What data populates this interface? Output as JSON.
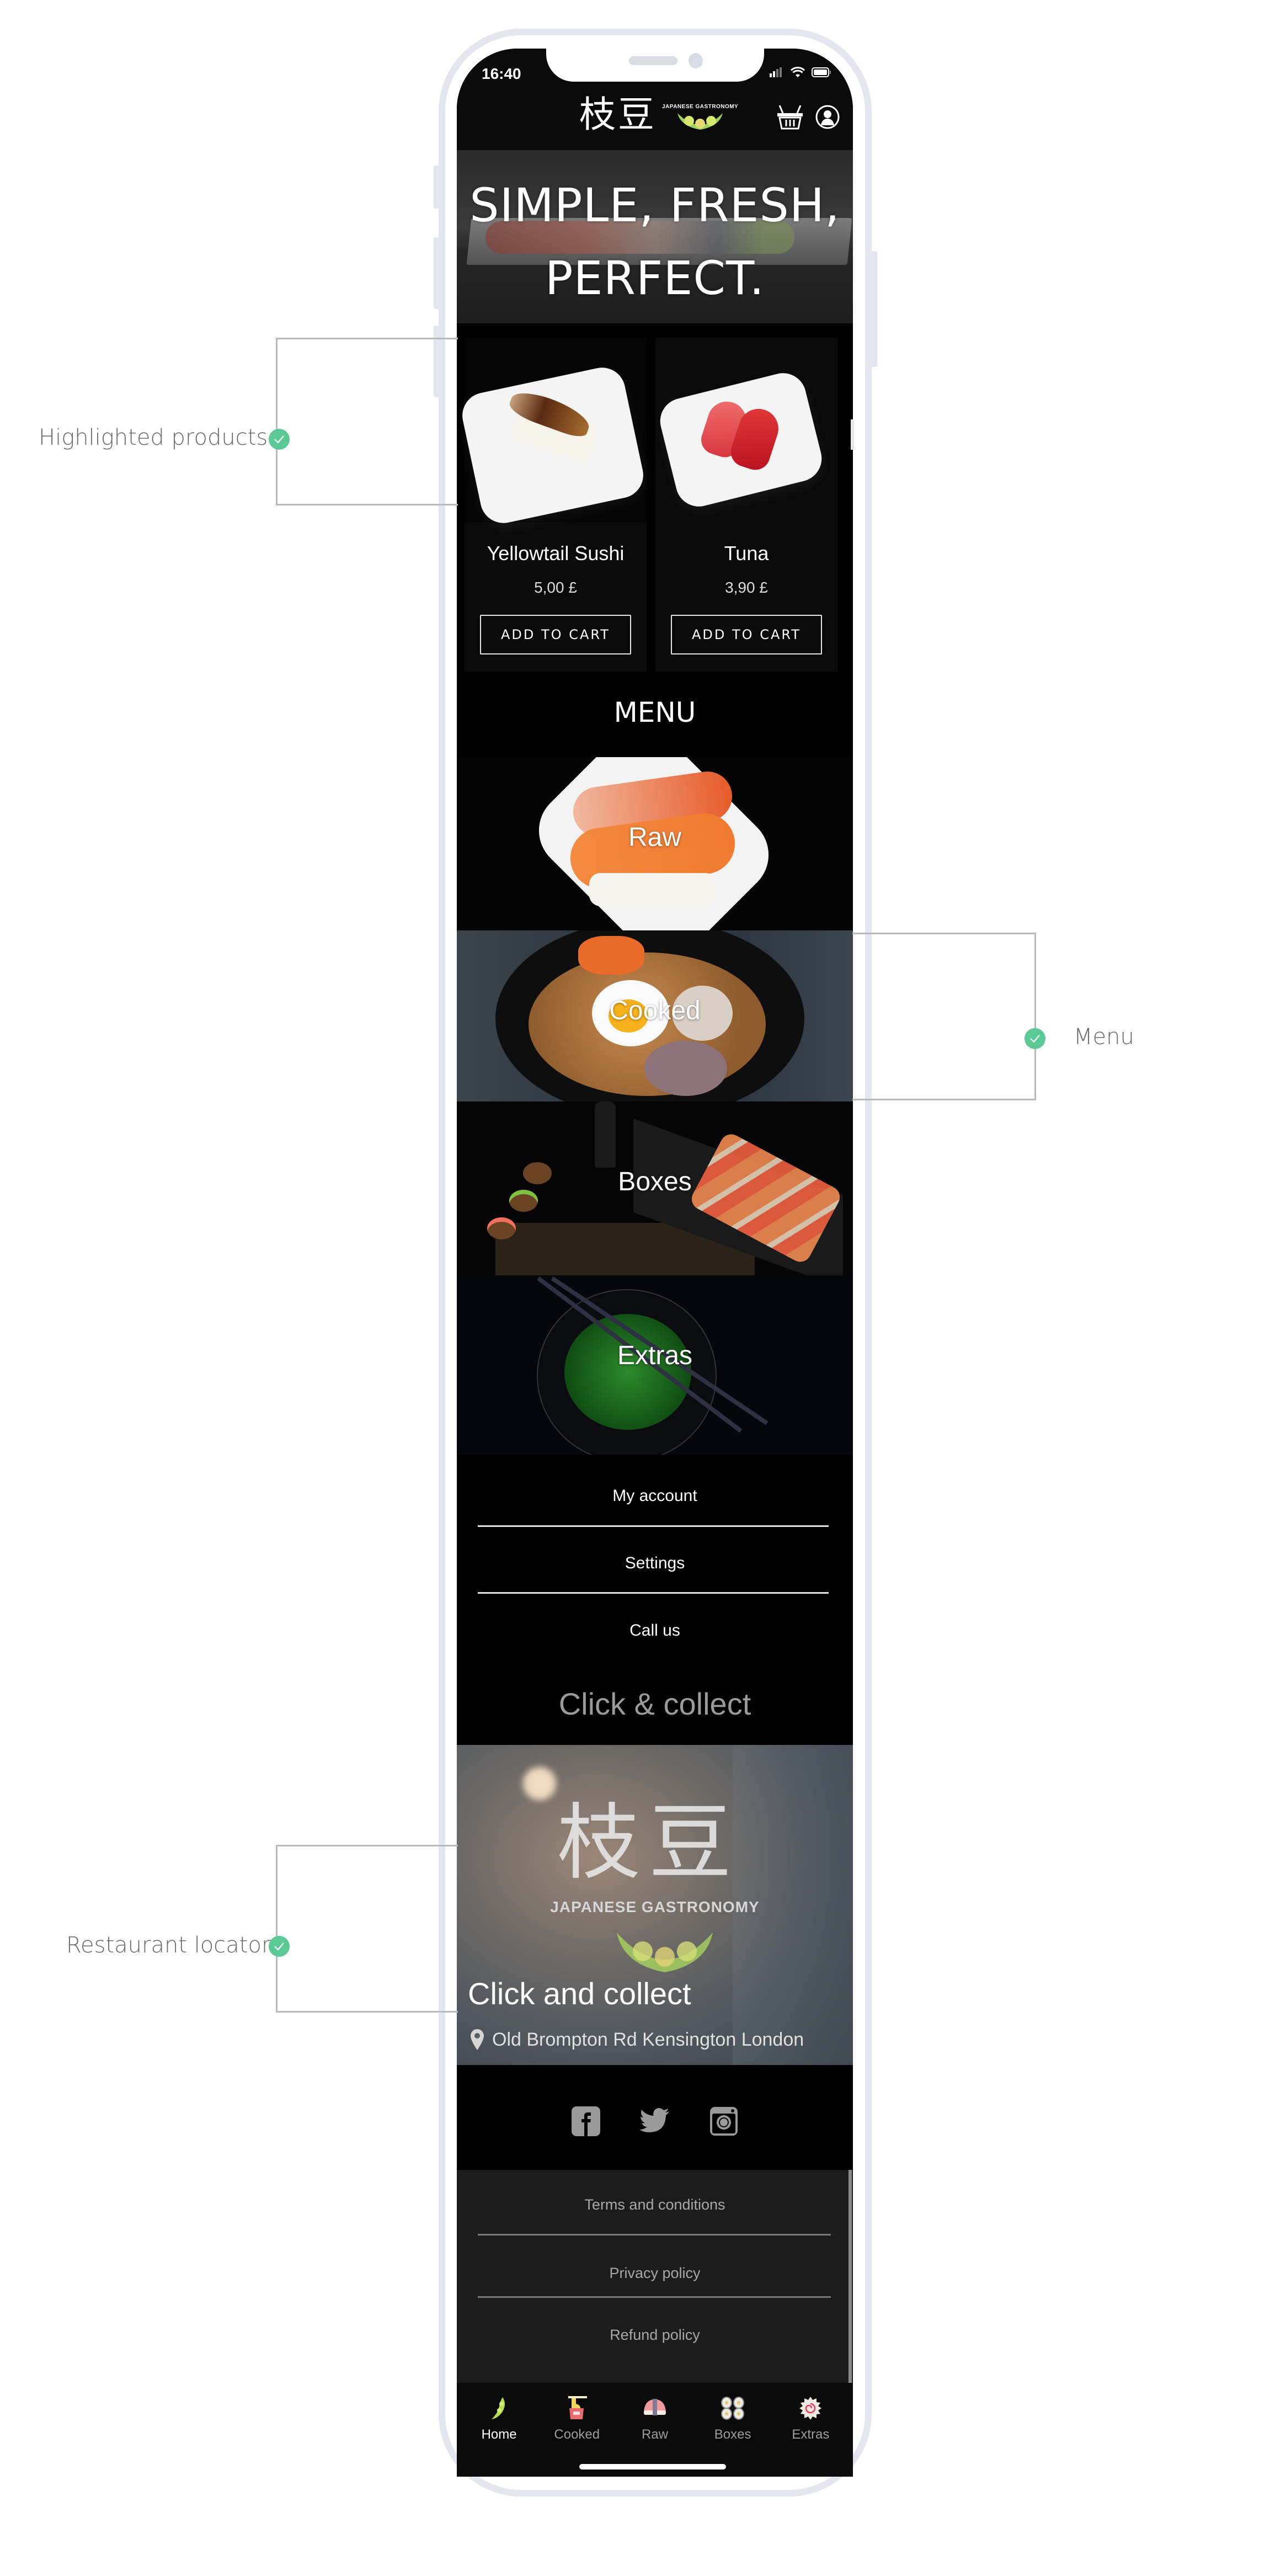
{
  "status_bar": {
    "time": "16:40"
  },
  "header": {
    "logo_kanji": "枝豆",
    "logo_tagline": "JAPANESE GASTRONOMY",
    "cart_icon": "basket-icon",
    "account_icon": "user-icon"
  },
  "hero": {
    "line1": "SIMPLE, FRESH,",
    "line2": "PERFECT."
  },
  "products": [
    {
      "name": "Yellowtail Sushi",
      "price": "5,00 £",
      "button": "ADD TO CART"
    },
    {
      "name": "Tuna",
      "price": "3,90 £",
      "button": "ADD TO CART"
    }
  ],
  "menu": {
    "title": "MENU",
    "categories": [
      {
        "label": "Raw"
      },
      {
        "label": "Cooked"
      },
      {
        "label": "Boxes"
      },
      {
        "label": "Extras"
      }
    ]
  },
  "account_links": [
    {
      "label": "My account"
    },
    {
      "label": "Settings"
    },
    {
      "label": "Call us"
    }
  ],
  "click_collect": {
    "section_title": "Click & collect",
    "card_title": "Click and collect",
    "address": "Old Brompton Rd Kensington London",
    "sign_kanji": "枝豆",
    "sign_tagline": "JAPANESE GASTRONOMY"
  },
  "social": [
    "facebook-icon",
    "twitter-icon",
    "instagram-icon"
  ],
  "legal_links": [
    {
      "label": "Terms and conditions"
    },
    {
      "label": "Privacy policy"
    },
    {
      "label": "Refund policy"
    }
  ],
  "tabbar": {
    "active": "Home",
    "tabs": [
      {
        "label": "Home",
        "icon": "edamame-icon"
      },
      {
        "label": "Cooked",
        "icon": "noodles-icon"
      },
      {
        "label": "Raw",
        "icon": "nigiri-icon"
      },
      {
        "label": "Boxes",
        "icon": "maki-icon"
      },
      {
        "label": "Extras",
        "icon": "narutomaki-icon"
      }
    ]
  },
  "annotations": [
    {
      "label": "Highlighted products"
    },
    {
      "label": "Menu"
    },
    {
      "label": "Restaurant locator"
    }
  ],
  "colors": {
    "annotation_badge": "#5ac994",
    "frame": "#e3e6ef",
    "screen_bg": "#000000",
    "legal_bg": "#1c1c1c"
  }
}
